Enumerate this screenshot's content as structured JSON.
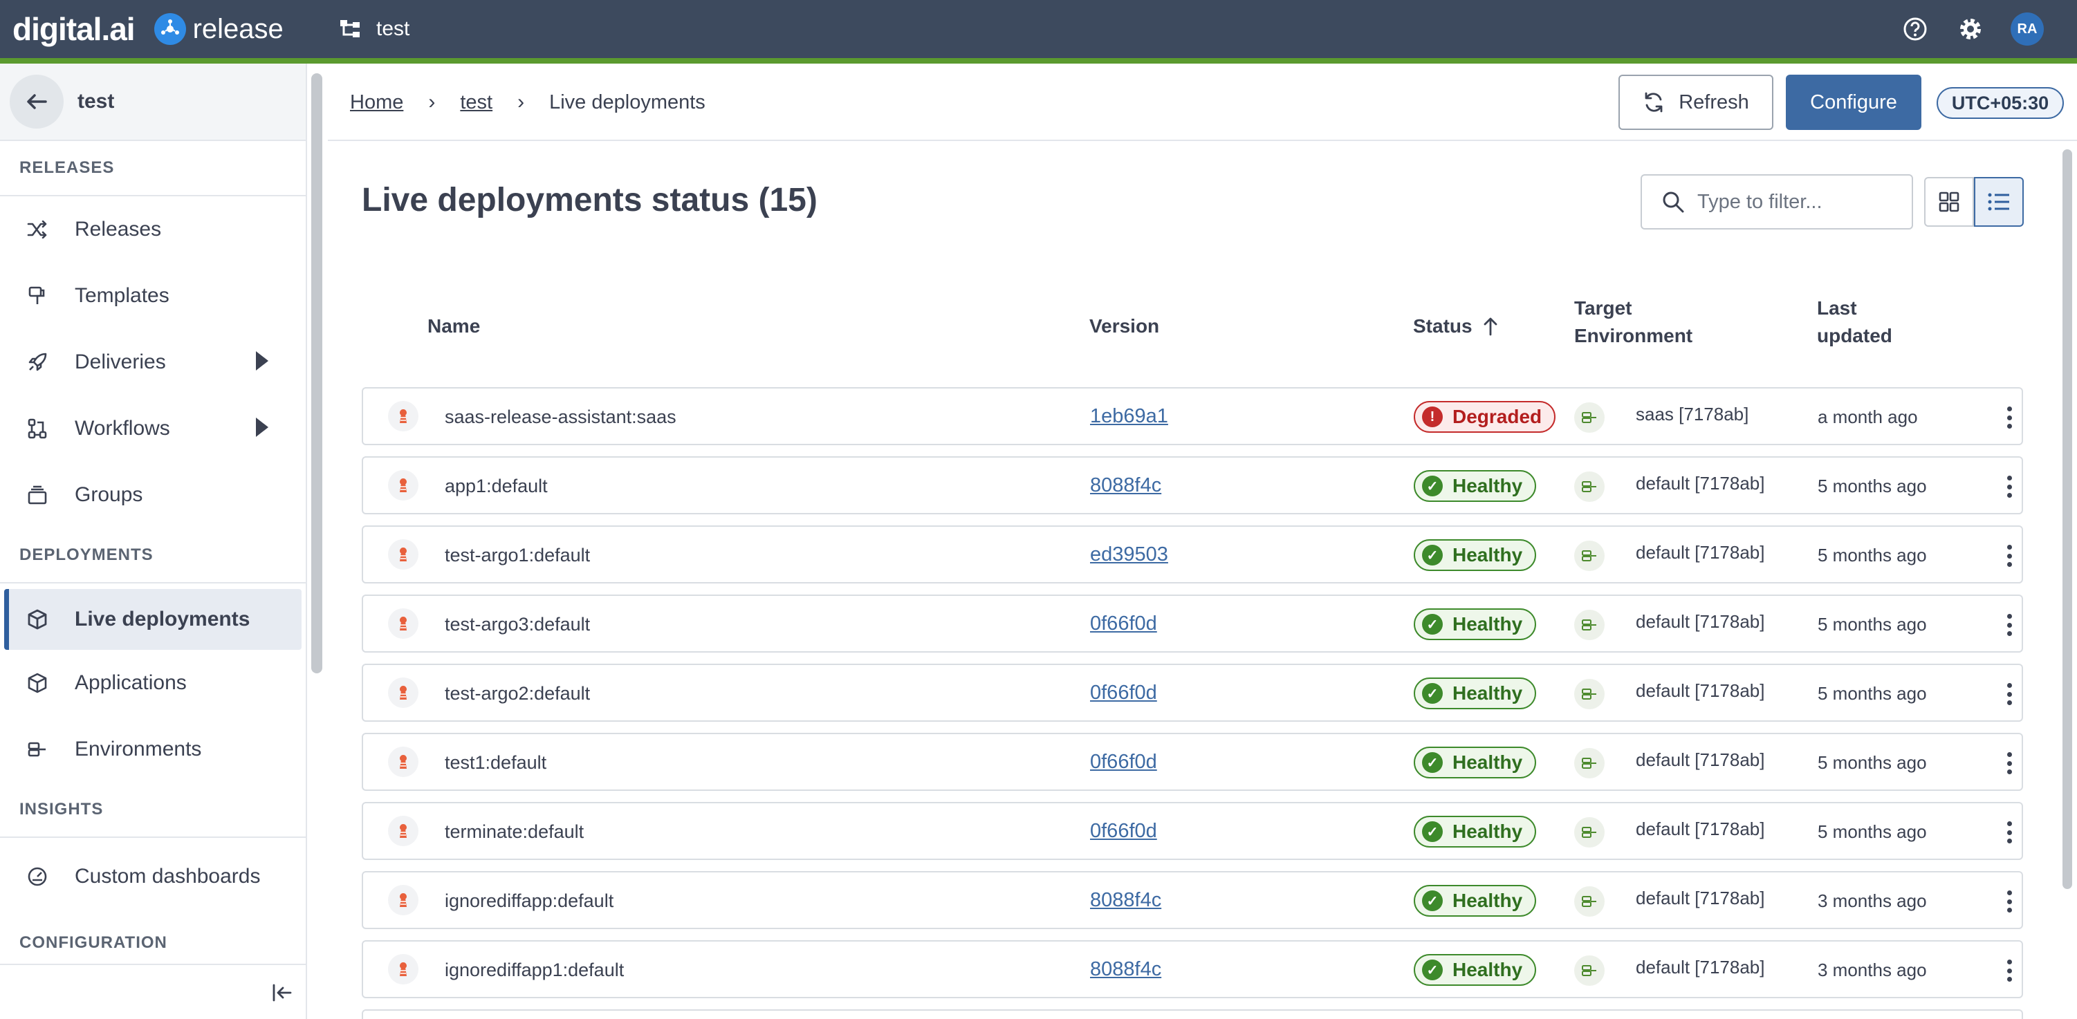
{
  "topbar": {
    "brand_digital": "digital.ai",
    "brand_product": "release",
    "folder": "test",
    "avatar_initials": "RA",
    "accent_color": "#5b9a2f"
  },
  "sidebar": {
    "title": "test",
    "sections": {
      "releases": "RELEASES",
      "deployments": "DEPLOYMENTS",
      "insights": "INSIGHTS",
      "configuration": "CONFIGURATION"
    },
    "items": [
      {
        "label": "Releases",
        "icon": "shuffle-icon"
      },
      {
        "label": "Templates",
        "icon": "template-icon"
      },
      {
        "label": "Deliveries",
        "icon": "rocket-icon"
      },
      {
        "label": "Workflows",
        "icon": "workflow-icon"
      },
      {
        "label": "Groups",
        "icon": "groups-icon"
      },
      {
        "label": "Live deployments",
        "icon": "cube-icon",
        "active": true
      },
      {
        "label": "Applications",
        "icon": "cube-icon"
      },
      {
        "label": "Environments",
        "icon": "environment-icon"
      },
      {
        "label": "Custom dashboards",
        "icon": "dashboard-icon"
      }
    ]
  },
  "header": {
    "breadcrumbs": [
      "Home",
      "test",
      "Live deployments"
    ],
    "refresh_label": "Refresh",
    "configure_label": "Configure",
    "timezone": "UTC+05:30"
  },
  "main": {
    "title": "Live deployments status (15)",
    "filter_placeholder": "Type to filter...",
    "columns": {
      "name": "Name",
      "version": "Version",
      "status": "Status",
      "target_env_1": "Target",
      "target_env_2": "Environment",
      "last_updated_1": "Last",
      "last_updated_2": "updated"
    },
    "rows": [
      {
        "name": "saas-release-assistant:saas",
        "version": "1eb69a1",
        "status": "Degraded",
        "environment": "saas [7178ab]",
        "updated": "a month ago"
      },
      {
        "name": "app1:default",
        "version": "8088f4c",
        "status": "Healthy",
        "environment": "default [7178ab]",
        "updated": "5 months ago"
      },
      {
        "name": "test-argo1:default",
        "version": "ed39503",
        "status": "Healthy",
        "environment": "default [7178ab]",
        "updated": "5 months ago"
      },
      {
        "name": "test-argo3:default",
        "version": "0f66f0d",
        "status": "Healthy",
        "environment": "default [7178ab]",
        "updated": "5 months ago"
      },
      {
        "name": "test-argo2:default",
        "version": "0f66f0d",
        "status": "Healthy",
        "environment": "default [7178ab]",
        "updated": "5 months ago"
      },
      {
        "name": "test1:default",
        "version": "0f66f0d",
        "status": "Healthy",
        "environment": "default [7178ab]",
        "updated": "5 months ago"
      },
      {
        "name": "terminate:default",
        "version": "0f66f0d",
        "status": "Healthy",
        "environment": "default [7178ab]",
        "updated": "5 months ago"
      },
      {
        "name": "ignorediffapp:default",
        "version": "8088f4c",
        "status": "Healthy",
        "environment": "default [7178ab]",
        "updated": "3 months ago"
      },
      {
        "name": "ignorediffapp1:default",
        "version": "8088f4c",
        "status": "Healthy",
        "environment": "default [7178ab]",
        "updated": "3 months ago"
      }
    ],
    "status_colors": {
      "healthy": "#3d8a2b",
      "degraded": "#c42b2b"
    }
  }
}
